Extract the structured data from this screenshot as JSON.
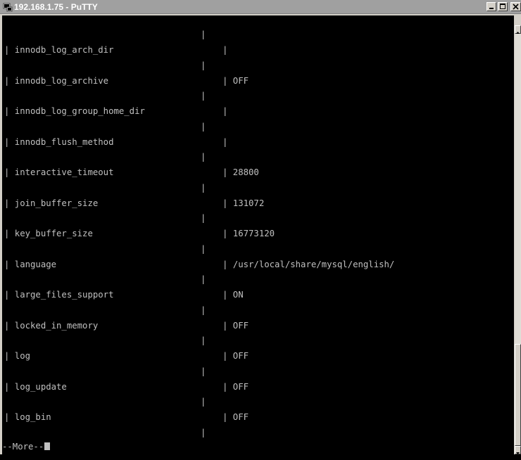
{
  "window": {
    "title": "192.168.1.75 - PuTTY",
    "icons": [
      "putty-icon",
      "minimize-icon",
      "maximize-icon",
      "close-icon"
    ]
  },
  "terminal": {
    "rows": [
      {
        "name": "| innodb_log_arch_dir",
        "value": "|"
      },
      {
        "name": "| innodb_log_archive",
        "value": "| OFF"
      },
      {
        "name": "| innodb_log_group_home_dir",
        "value": "|"
      },
      {
        "name": "| innodb_flush_method",
        "value": "|"
      },
      {
        "name": "| interactive_timeout",
        "value": "| 28800"
      },
      {
        "name": "| join_buffer_size",
        "value": "| 131072"
      },
      {
        "name": "| key_buffer_size",
        "value": "| 16773120"
      },
      {
        "name": "| language",
        "value": "| /usr/local/share/mysql/english/"
      },
      {
        "name": "| large_files_support",
        "value": "| ON"
      },
      {
        "name": "| locked_in_memory",
        "value": "| OFF"
      },
      {
        "name": "| log",
        "value": "| OFF"
      },
      {
        "name": "| log_update",
        "value": "| OFF"
      },
      {
        "name": "| log_bin",
        "value": "| OFF"
      }
    ],
    "separator": "|",
    "more_prompt": "--More--"
  },
  "colors": {
    "terminal_bg": "#000000",
    "terminal_fg": "#c0c0c0",
    "titlebar_bg": "#a0a0a0",
    "chrome": "#d4d0c8"
  }
}
